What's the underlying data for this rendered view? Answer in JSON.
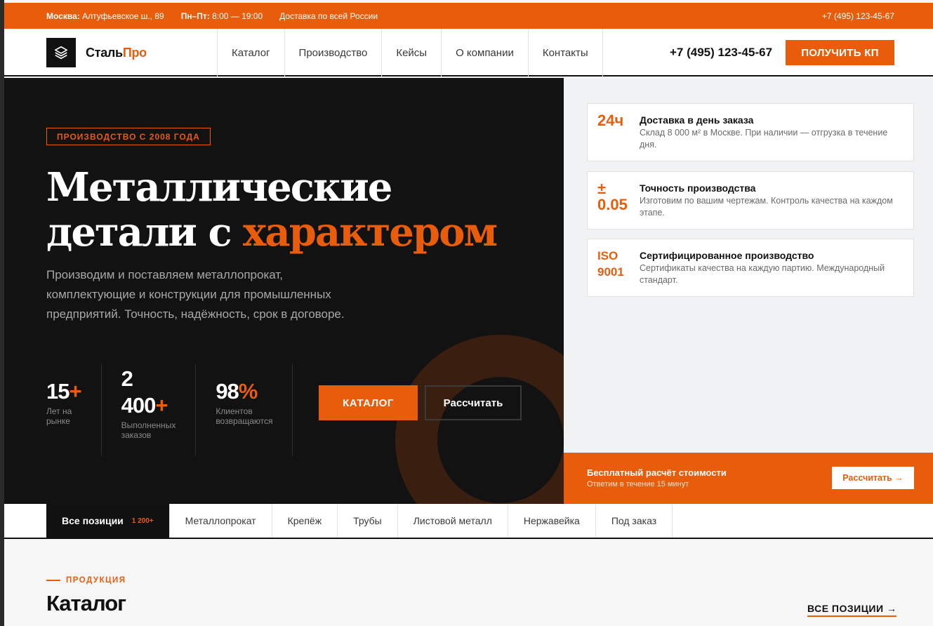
{
  "topbar": {
    "city": "Москва:",
    "address": "Алтуфьевское ш., 89",
    "hours_label": "Пн–Пт:",
    "hours": "8:00 — 19:00",
    "delivery": "Доставка по всей России",
    "phone": "+7 (495) 123-45-67"
  },
  "header": {
    "logo_part1": "Сталь",
    "logo_part2": "Про",
    "nav": [
      "Каталог",
      "Производство",
      "Кейсы",
      "О компании",
      "Контакты"
    ],
    "phone": "+7 (495) 123-45-67",
    "cta": "ПОЛУЧИТЬ КП"
  },
  "hero": {
    "badge": "ПРОИЗВОДСТВО С 2008 ГОДА",
    "title_line1": "Металлические",
    "title_line2a": "детали с ",
    "title_line2b": "характером",
    "lead": "Производим и поставляем металлопрокат, комплектующие и конструкции для промышленных предприятий. Точность, надёжность, срок в договоре.",
    "stats": [
      {
        "num": "15",
        "suffix": "+",
        "label1": "Лет на",
        "label2": "рынке"
      },
      {
        "num_line1": "2",
        "num_line2": "400",
        "suffix": "+",
        "label1": "Выполненных",
        "label2": "заказов"
      },
      {
        "num": "98",
        "suffix": "%",
        "label1": "Клиентов",
        "label2": "возвращаются"
      }
    ],
    "btn_catalog": "КАТАЛОГ",
    "btn_calc": "Рассчитать"
  },
  "features": [
    {
      "value": "24ч",
      "title": "Доставка в день заказа",
      "desc": "Склад 8 000 м² в Москве. При наличии — отгрузка в течение дня."
    },
    {
      "value_line1": "±",
      "value_line2": "0.05",
      "title": "Точность производства",
      "desc": "Изготовим по вашим чертежам. Контроль качества на каждом этапе."
    },
    {
      "value_line1": "ISO",
      "value_line2": "9001",
      "title": "Сертифицированное производство",
      "desc": "Сертификаты качества на каждую партию. Международный стандарт."
    }
  ],
  "promo": {
    "title": "Бесплатный расчёт стоимости",
    "subtitle": "Ответим в течение 15 минут",
    "button": "Рассчитать →"
  },
  "tabs": {
    "items": [
      "Все позиции",
      "Металлопрокат",
      "Крепёж",
      "Трубы",
      "Листовой металл",
      "Нержавейка",
      "Под заказ"
    ],
    "count": "1 200+"
  },
  "catalog": {
    "eyebrow": "ПРОДУКЦИЯ",
    "title": "Каталог",
    "all_link": "ВСЕ ПОЗИЦИИ →"
  },
  "colors": {
    "accent": "#e85d0c",
    "dark": "#121213",
    "light": "#f1f2f4"
  }
}
